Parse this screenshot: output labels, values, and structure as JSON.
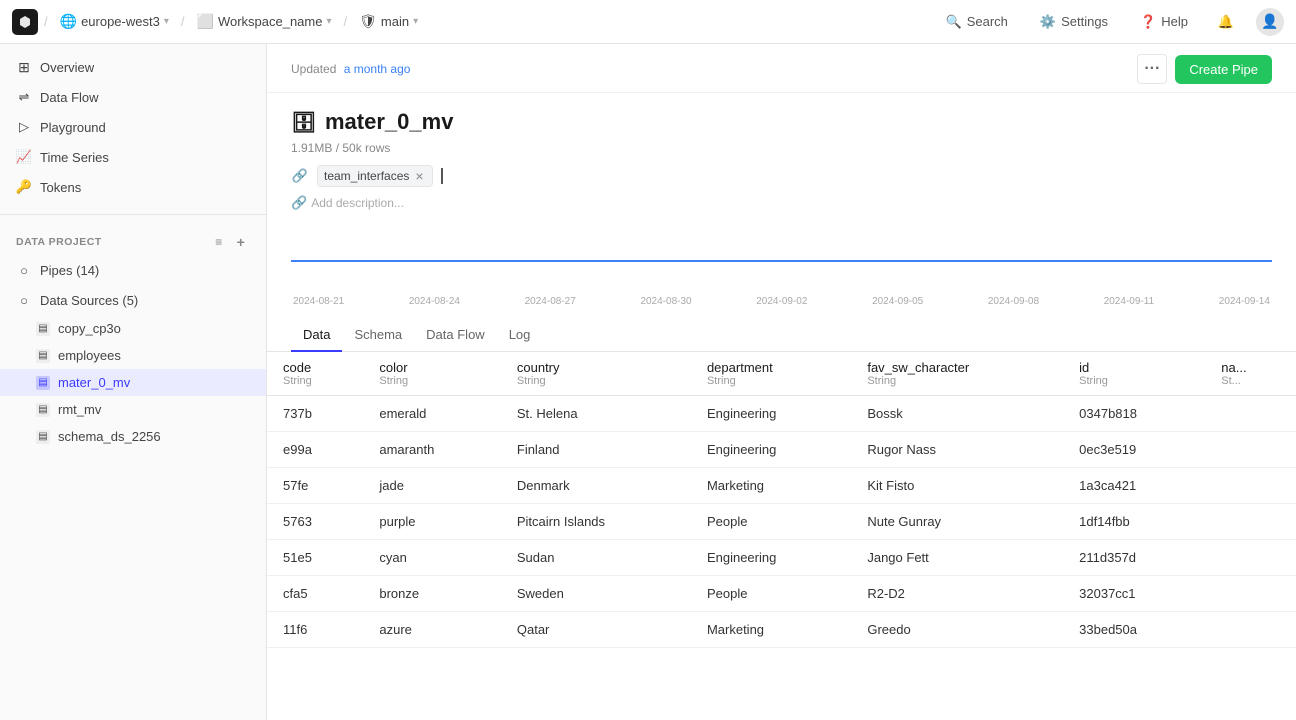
{
  "topnav": {
    "logo_icon": "tinybird-logo",
    "region": "europe-west3",
    "workspace": "Workspace_name",
    "branch": "main",
    "search_label": "Search",
    "settings_label": "Settings",
    "help_label": "Help",
    "notifications_icon": "notifications-icon",
    "profile_icon": "profile-icon"
  },
  "sidebar": {
    "overview_label": "Overview",
    "dataflow_label": "Data Flow",
    "playground_label": "Playground",
    "timeseries_label": "Time Series",
    "tokens_label": "Tokens",
    "data_project_label": "DATA PROJECT",
    "pipes_label": "Pipes (14)",
    "datasources_label": "Data Sources (5)",
    "items": [
      {
        "id": "copy_cp3o",
        "label": "copy_cp3o"
      },
      {
        "id": "employees",
        "label": "employees"
      },
      {
        "id": "mater_0_mv",
        "label": "mater_0_mv",
        "active": true
      },
      {
        "id": "rmt_mv",
        "label": "rmt_mv"
      },
      {
        "id": "schema_ds_2256",
        "label": "schema_ds_2256"
      }
    ]
  },
  "content": {
    "updated_text": "Updated",
    "updated_link": "a month ago",
    "more_button": "...",
    "create_pipe_button": "Create Pipe",
    "resource_icon": "data-source-icon",
    "resource_title": "mater_0_mv",
    "resource_size": "1.91MB / 50k rows",
    "tag_label": "team_interfaces",
    "add_description": "Add description...",
    "chart_dates": [
      "2024-08-21",
      "2024-08-24",
      "2024-08-27",
      "2024-08-30",
      "2024-09-02",
      "2024-09-05",
      "2024-09-08",
      "2024-09-11",
      "2024-09-14"
    ],
    "tabs": [
      "Data",
      "Schema",
      "Data Flow",
      "Log"
    ],
    "active_tab": "Data",
    "table": {
      "columns": [
        {
          "name": "code",
          "type": "String"
        },
        {
          "name": "color",
          "type": "String"
        },
        {
          "name": "country",
          "type": "String"
        },
        {
          "name": "department",
          "type": "String"
        },
        {
          "name": "fav_sw_character",
          "type": "String"
        },
        {
          "name": "id",
          "type": "String"
        },
        {
          "name": "na...",
          "type": "St..."
        }
      ],
      "rows": [
        {
          "code": "737b",
          "color": "emerald",
          "country": "St. Helena",
          "department": "Engineering",
          "fav_sw_character": "Bossk",
          "id": "0347b818"
        },
        {
          "code": "e99a",
          "color": "amaranth",
          "country": "Finland",
          "department": "Engineering",
          "fav_sw_character": "Rugor Nass",
          "id": "0ec3e519"
        },
        {
          "code": "57fe",
          "color": "jade",
          "country": "Denmark",
          "department": "Marketing",
          "fav_sw_character": "Kit Fisto",
          "id": "1a3ca421"
        },
        {
          "code": "5763",
          "color": "purple",
          "country": "Pitcairn Islands",
          "department": "People",
          "fav_sw_character": "Nute Gunray",
          "id": "1df14fbb"
        },
        {
          "code": "51e5",
          "color": "cyan",
          "country": "Sudan",
          "department": "Engineering",
          "fav_sw_character": "Jango Fett",
          "id": "211d357d"
        },
        {
          "code": "cfa5",
          "color": "bronze",
          "country": "Sweden",
          "department": "People",
          "fav_sw_character": "R2-D2",
          "id": "32037cc1"
        },
        {
          "code": "11f6",
          "color": "azure",
          "country": "Qatar",
          "department": "Marketing",
          "fav_sw_character": "Greedo",
          "id": "33bed50a"
        }
      ]
    }
  }
}
